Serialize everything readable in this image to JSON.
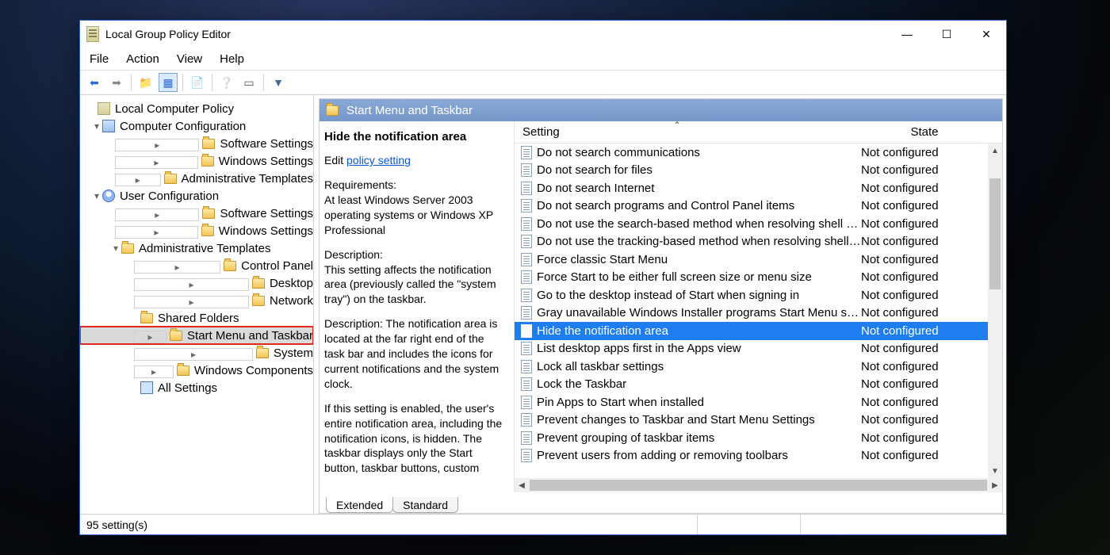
{
  "window": {
    "title": "Local Group Policy Editor"
  },
  "menu": {
    "file": "File",
    "action": "Action",
    "view": "View",
    "help": "Help"
  },
  "tree": {
    "root": "Local Computer Policy",
    "comp": "Computer Configuration",
    "comp_children": [
      "Software Settings",
      "Windows Settings",
      "Administrative Templates"
    ],
    "user": "User Configuration",
    "user_children": [
      "Software Settings",
      "Windows Settings"
    ],
    "admin": "Administrative Templates",
    "admin_children": [
      "Control Panel",
      "Desktop",
      "Network",
      "Shared Folders",
      "Start Menu and Taskbar",
      "System",
      "Windows Components",
      "All Settings"
    ]
  },
  "panel": {
    "heading": "Start Menu and Taskbar",
    "policy_title": "Hide the notification area",
    "edit_prefix": "Edit ",
    "edit_link": "policy setting",
    "req_label": "Requirements:",
    "req_text": "At least Windows Server 2003 operating systems or Windows XP Professional",
    "desc_label": "Description:",
    "desc1": "This setting affects the notification area (previously called the \"system tray\") on the taskbar.",
    "desc2": "Description: The notification area is located at the far right end of the task bar and includes the icons for current notifications and the system clock.",
    "desc3": "If this setting is enabled, the user's entire notification area, including the notification icons, is hidden. The taskbar displays only the Start button, taskbar buttons, custom"
  },
  "columns": {
    "setting": "Setting",
    "state": "State"
  },
  "settings": [
    {
      "name": "Do not search communications",
      "state": "Not configured"
    },
    {
      "name": "Do not search for files",
      "state": "Not configured"
    },
    {
      "name": "Do not search Internet",
      "state": "Not configured"
    },
    {
      "name": "Do not search programs and Control Panel items",
      "state": "Not configured"
    },
    {
      "name": "Do not use the search-based method when resolving shell s...",
      "state": "Not configured"
    },
    {
      "name": "Do not use the tracking-based method when resolving shell ...",
      "state": "Not configured"
    },
    {
      "name": "Force classic Start Menu",
      "state": "Not configured"
    },
    {
      "name": "Force Start to be either full screen size or menu size",
      "state": "Not configured"
    },
    {
      "name": "Go to the desktop instead of Start when signing in",
      "state": "Not configured"
    },
    {
      "name": "Gray unavailable Windows Installer programs Start Menu sh...",
      "state": "Not configured"
    },
    {
      "name": "Hide the notification area",
      "state": "Not configured",
      "selected": true
    },
    {
      "name": "List desktop apps first in the Apps view",
      "state": "Not configured"
    },
    {
      "name": "Lock all taskbar settings",
      "state": "Not configured"
    },
    {
      "name": "Lock the Taskbar",
      "state": "Not configured"
    },
    {
      "name": "Pin Apps to Start when installed",
      "state": "Not configured"
    },
    {
      "name": "Prevent changes to Taskbar and Start Menu Settings",
      "state": "Not configured"
    },
    {
      "name": "Prevent grouping of taskbar items",
      "state": "Not configured"
    },
    {
      "name": "Prevent users from adding or removing toolbars",
      "state": "Not configured"
    }
  ],
  "tabs": {
    "extended": "Extended",
    "standard": "Standard"
  },
  "status": {
    "text": "95 setting(s)"
  }
}
